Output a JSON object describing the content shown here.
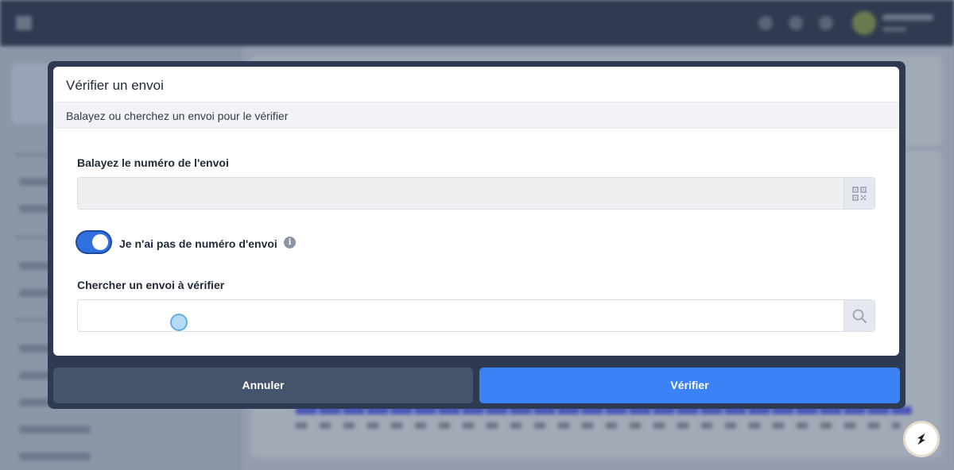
{
  "modal": {
    "title": "Vérifier un envoi",
    "subtitle": "Balayez ou cherchez un envoi pour le vérifier",
    "scan_label": "Balayez le numéro de l'envoi",
    "scan_value": "",
    "toggle_label": "Je n'ai pas de numéro d'envoi",
    "toggle_on": true,
    "search_label": "Chercher un envoi à vérifier",
    "search_value": "",
    "cancel_label": "Annuler",
    "verify_label": "Vérifier"
  },
  "icons": {
    "scan_button": "qr-code-icon",
    "search_button": "search-icon",
    "info": "info-icon",
    "help": "help-widget-icon"
  },
  "colors": {
    "primary": "#3b82f6",
    "toggle": "#2f6fe0",
    "cancel": "#45546d",
    "frame": "#2e3a52"
  }
}
